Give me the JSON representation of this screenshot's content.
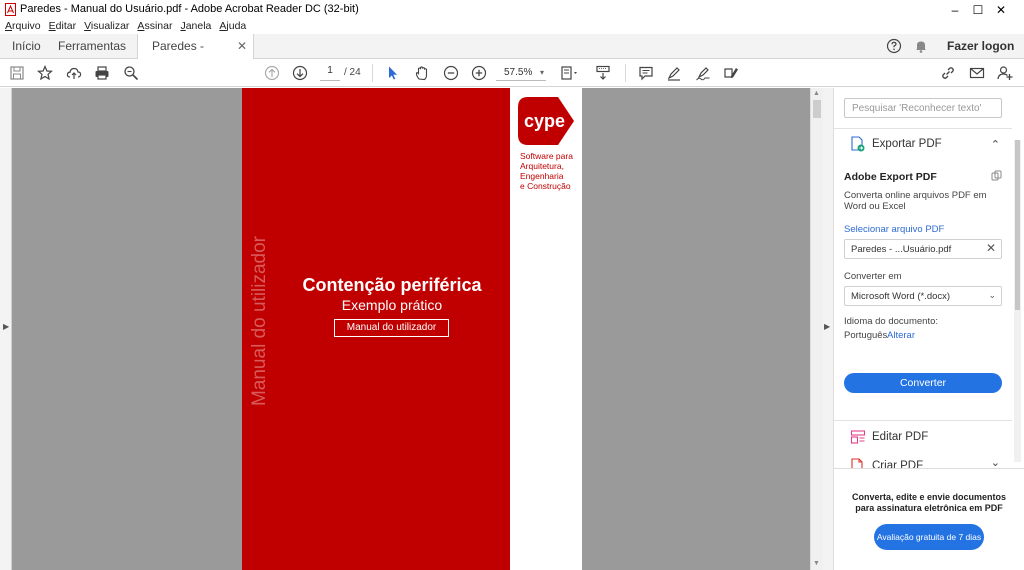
{
  "window": {
    "title": "Paredes - Manual do Usuário.pdf - Adobe Acrobat Reader DC (32-bit)",
    "minimize": "–",
    "maximize": "☐",
    "close": "✕"
  },
  "menu": [
    {
      "first": "A",
      "rest": "rquivo"
    },
    {
      "first": "E",
      "rest": "ditar"
    },
    {
      "first": "V",
      "rest": "isualizar"
    },
    {
      "first": "A",
      "rest": "ssinar"
    },
    {
      "first": "J",
      "rest": "anela"
    },
    {
      "first": "A",
      "rest": "juda"
    }
  ],
  "tabs": {
    "home": "Início",
    "tools": "Ferramentas",
    "document": "Paredes - Manual d...",
    "close": "✕",
    "login": "Fazer logon"
  },
  "toolbar": {
    "page_current": "1",
    "page_total": "/  24",
    "zoom": "57.5%",
    "zoom_caret": "▾",
    "accent_color": "#2d6bd4"
  },
  "document": {
    "vertical_text": "Manual do utilizador",
    "title": "Contenção periférica",
    "subtitle": "Exemplo prático",
    "manual_box": "Manual do utilizador",
    "logo_text": "cype",
    "tagline": [
      "Software para",
      "Arquitetura,",
      "Engenharia",
      "e Construção"
    ],
    "cover_color": "#c00000"
  },
  "panel": {
    "search_placeholder": "Pesquisar 'Reconhecer texto'",
    "export_title": "Exportar PDF",
    "export_chevron": "⌃",
    "adobe_export": "Adobe Export PDF",
    "desc_line1": "Converta online arquivos PDF em",
    "desc_line2": "Word ou Excel",
    "select_file": "Selecionar arquivo PDF",
    "file_name": "Paredes - ...Usuário.pdf",
    "file_clear": "✕",
    "convert_to_label": "Converter em",
    "format": "Microsoft Word (*.docx)",
    "format_caret": "⌄",
    "language_label": "Idioma do documento:",
    "language_value": "Português",
    "change_link": "Alterar",
    "convert_button": "Converter",
    "edit_pdf": "Editar PDF",
    "create_pdf": "Criar PDF",
    "create_chevron": "⌄",
    "promo_text": "Converta, edite e envie documentos para assinatura eletrônica em PDF",
    "trial_button": "Avaliação gratuita de 7 dias"
  }
}
